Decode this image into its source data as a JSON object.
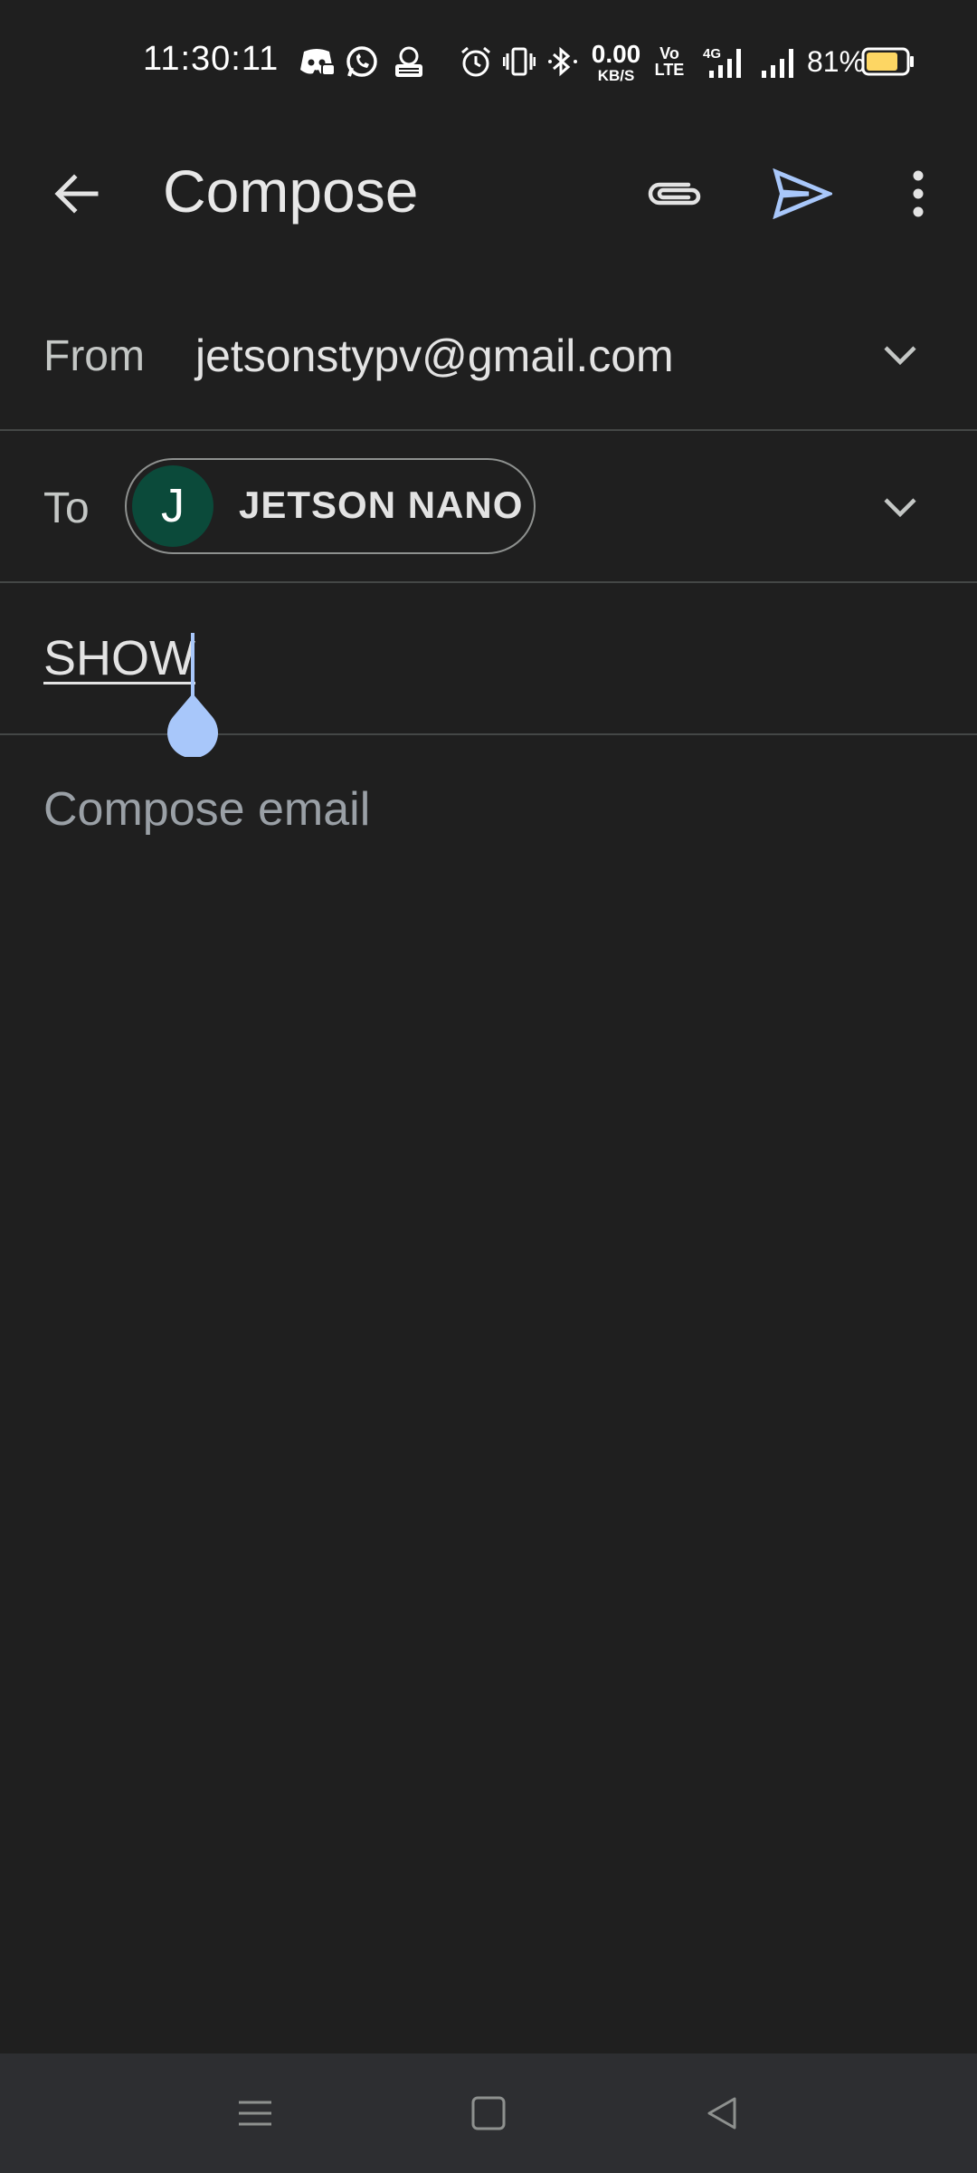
{
  "status_bar": {
    "time": "11:30:11",
    "net_speed_value": "0.00",
    "net_speed_unit": "KB/S",
    "volte_top": "Vo",
    "volte_bottom": "LTE",
    "network_type": "4G",
    "battery_percent": "81%",
    "battery_level": 0.81,
    "icons": [
      "discord-icon",
      "whatsapp-icon",
      "app-icon",
      "alarm-icon",
      "vibrate-icon",
      "bluetooth-icon",
      "signal-icon",
      "battery-icon"
    ]
  },
  "app_bar": {
    "title": "Compose",
    "icons": [
      "back-arrow-icon",
      "paperclip-icon",
      "send-icon",
      "more-vert-icon"
    ]
  },
  "from": {
    "label": "From",
    "value": "jetsonstypv@gmail.com"
  },
  "to": {
    "label": "To",
    "recipient_initial": "J",
    "recipient_name": "JETSON NANO"
  },
  "subject": {
    "value": "SHOW"
  },
  "body": {
    "placeholder": "Compose email"
  },
  "colors": {
    "background": "#1f1f1f",
    "accent": "#a8c7fa",
    "avatar": "#0b4a3a",
    "battery": "#fdd663",
    "nav_bar": "#2d2e31"
  }
}
